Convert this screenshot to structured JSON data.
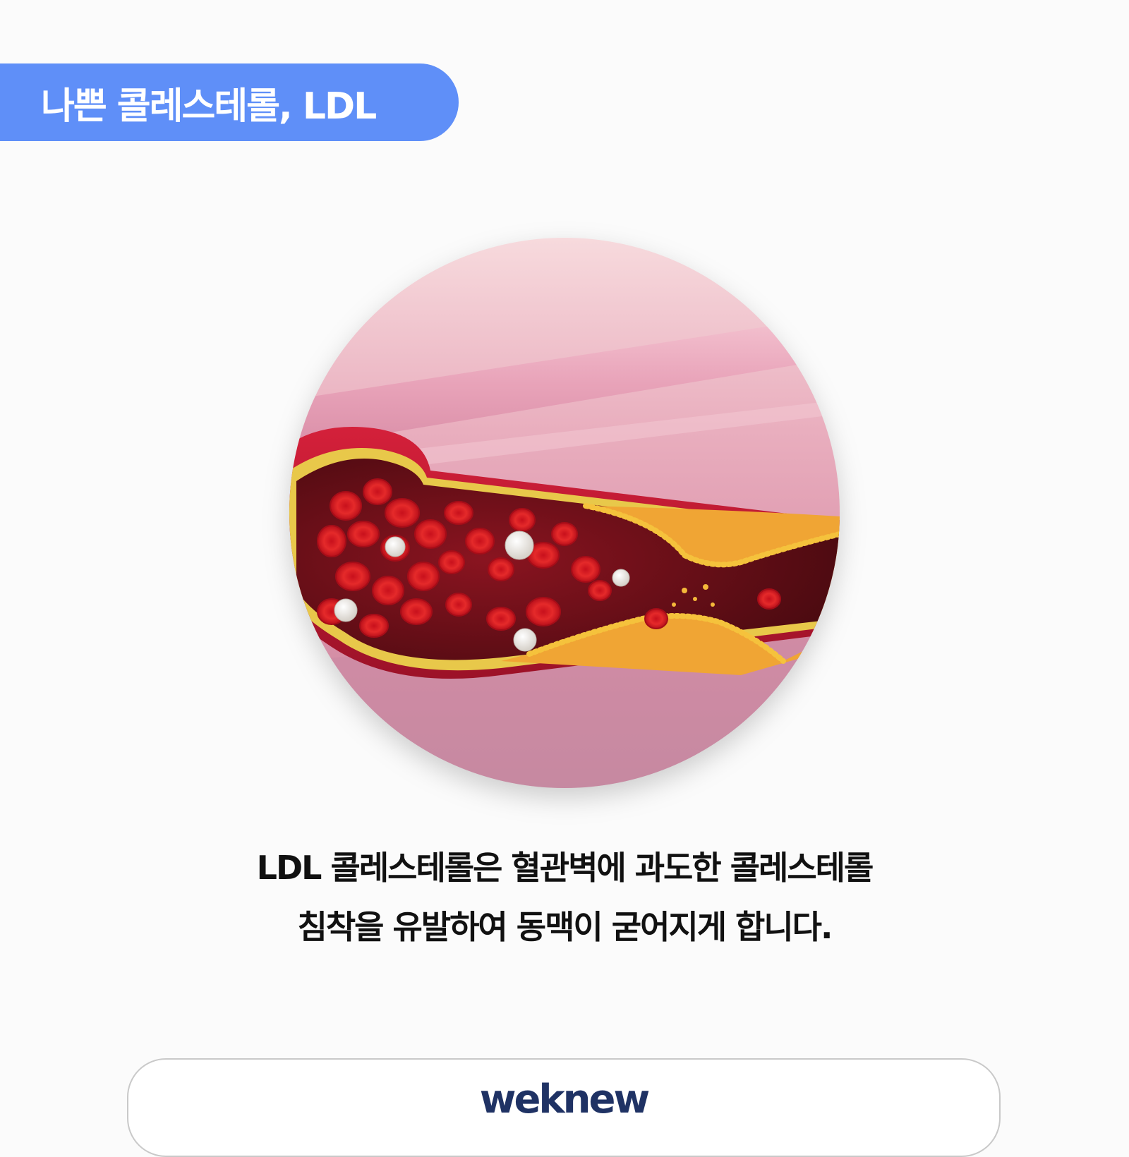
{
  "header": {
    "title": "나쁜 콜레스테롤, LDL"
  },
  "illustration": {
    "icon": "artery-cholesterol-plaque-illustration"
  },
  "caption": {
    "line1": "LDL 콜레스테롤은 혈관벽에 과도한 콜레스테롤",
    "line2": "침착을 유발하여 동맥이 굳어지게 합니다."
  },
  "footer": {
    "brand": "weknew"
  },
  "colors": {
    "accent": "#5f8ff8",
    "brand": "#1f3264",
    "text": "#111111",
    "background": "#fbfbfb"
  }
}
